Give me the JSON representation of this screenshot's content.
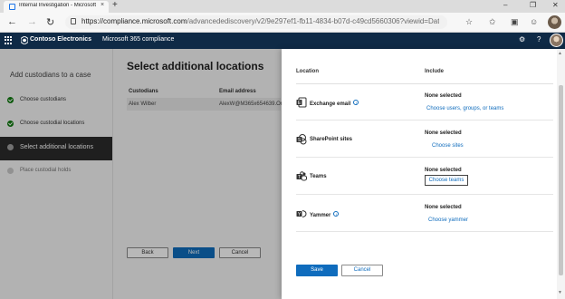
{
  "browser": {
    "tab_title": "Internal Investigation - Microsoft",
    "tab_close": "×",
    "new_tab": "+",
    "url_main": "https://compliance.microsoft.com",
    "url_rest": "/advancedediscovery/v2/9e297ef1-fb11-4834-b07d-c49cd5660306?viewid=Data...",
    "icons": [
      "back-arrow-icon",
      "forward-arrow-icon",
      "refresh-icon",
      "lock-icon",
      "star-icon",
      "favorites-icon",
      "collections-icon",
      "profile-icon",
      "more-icon"
    ]
  },
  "app_header": {
    "brand": "Contoso Electronics",
    "app_name": "Microsoft 365 compliance",
    "icons": [
      "waffle-icon",
      "settings-icon",
      "help-icon"
    ]
  },
  "wizard": {
    "title": "Add custodians to a case",
    "steps": [
      {
        "label": "Choose custodians",
        "state": "done"
      },
      {
        "label": "Choose custodial locations",
        "state": "done"
      },
      {
        "label": "Select additional locations",
        "state": "active"
      },
      {
        "label": "Place custodial holds",
        "state": "todo"
      }
    ],
    "main_title": "Select additional locations",
    "table": {
      "headers": [
        "Custodians",
        "Email address"
      ],
      "rows": [
        [
          "Alex Wilber",
          "AlexW@M365x654639.OnMi"
        ]
      ]
    },
    "buttons": {
      "back": "Back",
      "next": "Next",
      "cancel": "Cancel"
    }
  },
  "panel": {
    "col_location": "Location",
    "col_include": "Include",
    "rows": [
      {
        "name": "Exchange email",
        "status": "None selected",
        "action": "Choose users, groups, or teams",
        "info": true
      },
      {
        "name": "SharePoint sites",
        "status": "None selected",
        "action": "Choose sites",
        "info": false
      },
      {
        "name": "Teams",
        "status": "None selected",
        "action": "Choose teams",
        "info": false
      },
      {
        "name": "Yammer",
        "status": "None selected",
        "action": "Choose yammer",
        "info": true
      }
    ],
    "info_glyph": "i",
    "save": "Save",
    "cancel": "Cancel"
  },
  "colors": {
    "app_header": "#0f2a46",
    "primary": "#0f6cbd",
    "success": "#107c10",
    "active_step": "#2c2c2c"
  }
}
